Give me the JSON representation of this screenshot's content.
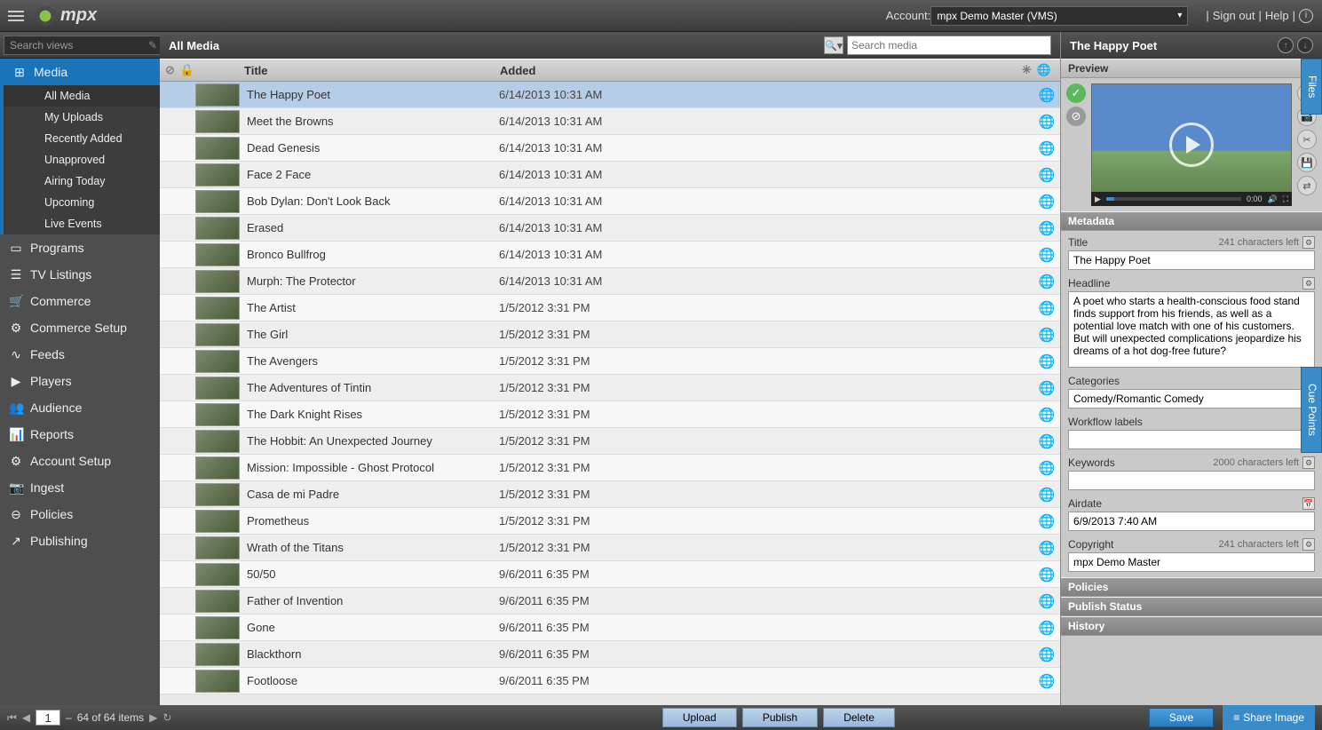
{
  "topbar": {
    "brand": "mpx",
    "account_label": "Account:",
    "account_value": "mpx Demo Master (VMS)",
    "signout": "Sign out",
    "help": "Help"
  },
  "search": {
    "views_placeholder": "Search views",
    "media_placeholder": "Search media"
  },
  "sidebar": {
    "main": [
      {
        "label": "Media",
        "icon": "⊞",
        "active": true
      },
      {
        "label": "Programs",
        "icon": "▭"
      },
      {
        "label": "TV Listings",
        "icon": "☰"
      },
      {
        "label": "Commerce",
        "icon": "🛒"
      },
      {
        "label": "Commerce Setup",
        "icon": "⚙"
      },
      {
        "label": "Feeds",
        "icon": "∿"
      },
      {
        "label": "Players",
        "icon": "▶"
      },
      {
        "label": "Audience",
        "icon": "👥"
      },
      {
        "label": "Reports",
        "icon": "📊"
      },
      {
        "label": "Account Setup",
        "icon": "⚙"
      },
      {
        "label": "Ingest",
        "icon": "📷"
      },
      {
        "label": "Policies",
        "icon": "⊖"
      },
      {
        "label": "Publishing",
        "icon": "↗"
      }
    ],
    "media_sub": [
      {
        "label": "All Media",
        "active": true
      },
      {
        "label": "My Uploads"
      },
      {
        "label": "Recently Added"
      },
      {
        "label": "Unapproved"
      },
      {
        "label": "Airing Today"
      },
      {
        "label": "Upcoming"
      },
      {
        "label": "Live Events"
      }
    ]
  },
  "center": {
    "title": "All Media",
    "columns": {
      "title": "Title",
      "added": "Added"
    },
    "rows": [
      {
        "title": "The Happy Poet",
        "added": "6/14/2013 10:31 AM",
        "selected": true
      },
      {
        "title": "Meet the Browns",
        "added": "6/14/2013 10:31 AM"
      },
      {
        "title": "Dead Genesis",
        "added": "6/14/2013 10:31 AM"
      },
      {
        "title": "Face 2 Face",
        "added": "6/14/2013 10:31 AM"
      },
      {
        "title": "Bob Dylan: Don't Look Back",
        "added": "6/14/2013 10:31 AM"
      },
      {
        "title": "Erased",
        "added": "6/14/2013 10:31 AM"
      },
      {
        "title": "Bronco Bullfrog",
        "added": "6/14/2013 10:31 AM"
      },
      {
        "title": "Murph: The Protector",
        "added": "6/14/2013 10:31 AM"
      },
      {
        "title": "The Artist",
        "added": "1/5/2012 3:31 PM"
      },
      {
        "title": "The Girl",
        "added": "1/5/2012 3:31 PM"
      },
      {
        "title": "The Avengers",
        "added": "1/5/2012 3:31 PM"
      },
      {
        "title": "The Adventures of Tintin",
        "added": "1/5/2012 3:31 PM"
      },
      {
        "title": "The Dark Knight Rises",
        "added": "1/5/2012 3:31 PM"
      },
      {
        "title": "The Hobbit: An Unexpected Journey",
        "added": "1/5/2012 3:31 PM"
      },
      {
        "title": "Mission: Impossible - Ghost Protocol",
        "added": "1/5/2012 3:31 PM"
      },
      {
        "title": "Casa de mi Padre",
        "added": "1/5/2012 3:31 PM"
      },
      {
        "title": "Prometheus",
        "added": "1/5/2012 3:31 PM"
      },
      {
        "title": "Wrath of the Titans",
        "added": "1/5/2012 3:31 PM"
      },
      {
        "title": "50/50",
        "added": "9/6/2011 6:35 PM"
      },
      {
        "title": "Father of Invention",
        "added": "9/6/2011 6:35 PM"
      },
      {
        "title": "Gone",
        "added": "9/6/2011 6:35 PM"
      },
      {
        "title": "Blackthorn",
        "added": "9/6/2011 6:35 PM"
      },
      {
        "title": "Footloose",
        "added": "9/6/2011 6:35 PM"
      }
    ]
  },
  "right": {
    "title": "The Happy Poet",
    "preview_label": "Preview",
    "video_time": "0:00",
    "metadata_label": "Metadata",
    "fields": {
      "title_label": "Title",
      "title_hint": "241 characters left",
      "title_value": "The Happy Poet",
      "headline_label": "Headline",
      "headline_value": "A poet who starts a health-conscious food stand finds support from his friends, as well as a potential love match with one of his customers. But will unexpected complications jeopardize his dreams of a hot dog-free future?",
      "categories_label": "Categories",
      "categories_value": "Comedy/Romantic Comedy",
      "workflow_label": "Workflow labels",
      "workflow_value": "",
      "keywords_label": "Keywords",
      "keywords_hint": "2000 characters left",
      "keywords_value": "",
      "airdate_label": "Airdate",
      "airdate_value": "6/9/2013 7:40 AM",
      "copyright_label": "Copyright",
      "copyright_hint": "241 characters left",
      "copyright_value": "mpx Demo Master"
    },
    "sections": {
      "policies": "Policies",
      "publish": "Publish Status",
      "history": "History"
    }
  },
  "side_tabs": {
    "files": "Files",
    "cue": "Cue Points"
  },
  "bottom": {
    "page": "1",
    "range": "64 of 64 items",
    "upload": "Upload",
    "publish": "Publish",
    "delete": "Delete",
    "save": "Save",
    "share": "Share Image"
  }
}
